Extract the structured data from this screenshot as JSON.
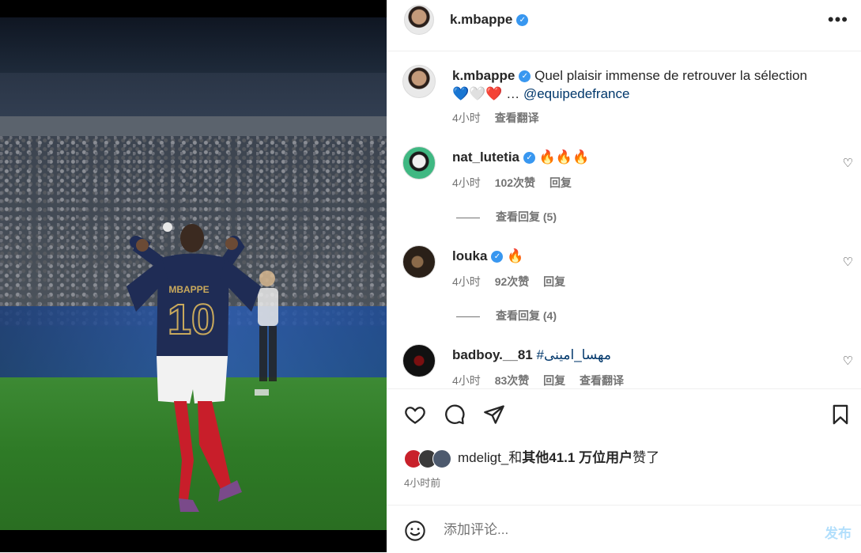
{
  "header": {
    "username": "k.mbappe",
    "verified_icon": "verified-badge-icon",
    "more_icon": "more-options-icon"
  },
  "caption": {
    "username": "k.mbappe",
    "text": "Quel plaisir immense de retrouver la sélection",
    "line2_prefix": "💙🤍❤️ …",
    "mention": "@equipedefrance",
    "time": "4小时",
    "translate": "查看翻译"
  },
  "comments": [
    {
      "username": "nat_lutetia",
      "text": "🔥🔥🔥",
      "time": "4小时",
      "likes": "102次赞",
      "reply": "回复",
      "view_replies": "查看回复 (5)"
    },
    {
      "username": "louka",
      "text": "🔥",
      "time": "4小时",
      "likes": "92次赞",
      "reply": "回复",
      "view_replies": "查看回复 (4)"
    },
    {
      "username": "badboy.__81",
      "text": "#مهسا_امینی",
      "time": "4小时",
      "likes": "83次赞",
      "reply": "回复",
      "translate": "查看翻译"
    }
  ],
  "actions": {
    "like_icon": "heart-icon",
    "comment_icon": "comment-icon",
    "share_icon": "send-icon",
    "save_icon": "bookmark-icon"
  },
  "likes": {
    "user": "mdeligt_",
    "and": "和",
    "others": "其他41.1 万位用户",
    "suffix": "赞了"
  },
  "time_ago": "4小时前",
  "add_comment": {
    "placeholder": "添加评论...",
    "post_label": "发布",
    "emoji_icon": "emoji-icon"
  },
  "photo": {
    "jersey_name": "MBAPPE",
    "jersey_number": "10"
  },
  "colors": {
    "verified": "#3897f0",
    "link": "#00376b",
    "post_button_disabled": "#b2dffc",
    "muted": "#737373"
  }
}
